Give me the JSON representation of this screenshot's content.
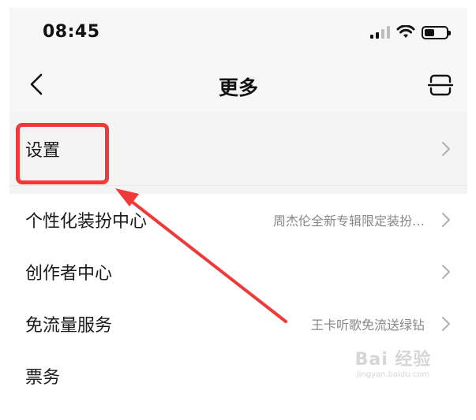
{
  "status_bar": {
    "time": "08:45"
  },
  "nav": {
    "title": "更多"
  },
  "rows": [
    {
      "label": "设置",
      "sub": ""
    },
    {
      "label": "个性化装扮中心",
      "sub": "周杰伦全新专辑限定装扮…"
    },
    {
      "label": "创作者中心",
      "sub": ""
    },
    {
      "label": "免流量服务",
      "sub": "王卡听歌免流送绿钻"
    },
    {
      "label": "票务",
      "sub": ""
    }
  ],
  "watermark": {
    "main": "Bai 经验",
    "sub": "jingyan.baidu.com"
  },
  "colors": {
    "highlight": "#f03a3a",
    "background": "#f7f7f7",
    "text": "#1a1a1a",
    "subtext": "#888888"
  }
}
